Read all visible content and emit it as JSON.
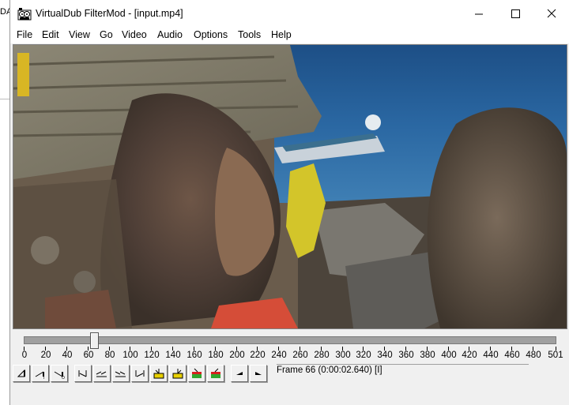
{
  "background_window": {
    "visible_text": "DA"
  },
  "window": {
    "title": "VirtualDub FilterMod  - [input.mp4]",
    "icon": "film-reel-icon",
    "controls": [
      "minimize-icon",
      "maximize-icon",
      "close-icon"
    ]
  },
  "menu": {
    "items": [
      {
        "label": "File"
      },
      {
        "label": "Edit"
      },
      {
        "label": "View"
      },
      {
        "label": "Go"
      },
      {
        "label": "Video"
      },
      {
        "label": "Audio"
      },
      {
        "label": "Options"
      },
      {
        "label": "Tools"
      },
      {
        "label": "Help"
      }
    ]
  },
  "timeline": {
    "ticks": [
      "0",
      "20",
      "40",
      "60",
      "80",
      "100",
      "120",
      "140",
      "160",
      "180",
      "200",
      "220",
      "240",
      "260",
      "280",
      "300",
      "320",
      "340",
      "360",
      "380",
      "400",
      "420",
      "440",
      "460",
      "480",
      "501"
    ],
    "current_frame": 66,
    "total_frames": 501
  },
  "toolbar": {
    "buttons": [
      {
        "name": "stop-icon"
      },
      {
        "name": "play-input-icon"
      },
      {
        "name": "play-output-icon"
      },
      {
        "name": "go-start-icon"
      },
      {
        "name": "prev-frame-icon"
      },
      {
        "name": "next-frame-icon"
      },
      {
        "name": "go-end-icon"
      },
      {
        "name": "prev-keyframe-icon"
      },
      {
        "name": "next-keyframe-icon"
      },
      {
        "name": "scene-back-icon"
      },
      {
        "name": "scene-forward-icon"
      },
      {
        "name": "mark-in-icon"
      },
      {
        "name": "mark-out-icon"
      }
    ]
  },
  "status": {
    "frame_text": "Frame 66 (0:00:02.640) [I]"
  }
}
